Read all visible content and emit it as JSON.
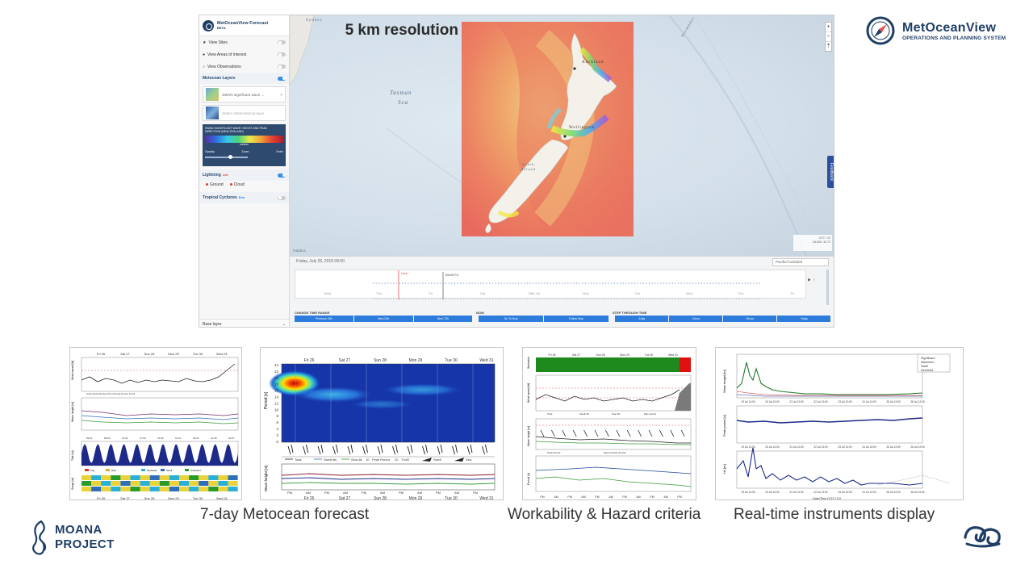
{
  "app": {
    "brand_title": "MetOceanView Forecast",
    "brand_badge": "BETA",
    "menu": [
      {
        "label": "View Sites",
        "icon": "star-icon",
        "on": false
      },
      {
        "label": "View Areas of interest",
        "icon": "circle-filled-icon",
        "on": false
      },
      {
        "label": "View Observations",
        "icon": "circle-outline-icon",
        "on": false
      }
    ],
    "metocean_layers_label": "Metocean Layers",
    "layer_name": "SWAN significant wave ...",
    "observational_placeholder": "Select observational layer",
    "legend_title": "SWAN SIGNIFICANT WAVE HEIGHT AND PEAK DIRECTION (NEW ZEALAND)",
    "legend_unit": "metres",
    "opacity_label": "Opacity",
    "zoom_label": "Zoom",
    "order_label": "Order",
    "lightning_label": "Lightning",
    "lightning_badge": "Live",
    "ground_label": "Ground",
    "cloud_label": "Cloud",
    "cyclones_label": "Tropical Cyclones",
    "cyclones_badge": "Beta",
    "base_layer_label": "Base layer"
  },
  "map": {
    "resolution_label": "5 km resolution",
    "sea_label_1": "Tasman",
    "sea_label_2": "Sea",
    "city_sydney": "Sydney",
    "city_auckland": "Auckland",
    "city_wellington": "Wellington",
    "island_label_1": "South",
    "island_label_2": "Island",
    "kermadec_label": "Kermadec",
    "feedback_label": "Feedback",
    "utc_label": "UTC +12",
    "coords": "-36.845  -40.73",
    "mapbox_label": "mapbox"
  },
  "timeline": {
    "current_date": "Friday, July 26, 2019 09:00",
    "timezone": "Pacific/Auckland",
    "now_label": "Now",
    "cursor_label": "09:00 Fri",
    "day_ticks": [
      "Wed",
      "Thu",
      "Fri",
      "Sat",
      "28th Jul",
      "Mon",
      "Tue",
      "Wed",
      "Thu",
      "Fri"
    ],
    "section_range": "CHANGE TIME RANGE",
    "section_now": "NOW",
    "section_step": "STEP THROUGH TIME",
    "range_buttons": [
      "Previous 24h",
      "Next 24h",
      "Next 72h"
    ],
    "now_buttons": [
      "Go To Now",
      "Follow Now"
    ],
    "step_buttons": [
      "-1day",
      "-1hour",
      "+1hour",
      "+1day"
    ]
  },
  "brand": {
    "name": "MetOceanView",
    "tagline": "OPERATIONS AND PLANNING SYSTEM",
    "moana_line1": "MOANA",
    "moana_line2": "PROJECT"
  },
  "panels": {
    "days": [
      "Fri 26",
      "Sat 27",
      "Sun 28",
      "Mon 29",
      "Tue 30",
      "Wed 31"
    ],
    "tide_times": [
      "05:21",
      "08:34",
      "11:34",
      "17:59",
      "21:00",
      "01:01",
      "06:22",
      "12:38",
      "18:27"
    ],
    "ampm": [
      "PM",
      "AM",
      "PM",
      "AM",
      "PM",
      "AM",
      "PM",
      "AM",
      "PM",
      "AM",
      "PM"
    ],
    "p1_ylabels": [
      "Wind speed [kt]",
      "Wave height [m]",
      "Tide [m]",
      "Surge [m]"
    ],
    "p1_legend_wind": "Total   Swell>8s   Sea<8s  10 Peak Period  Tm02",
    "p1_legend_weather": [
      "Fog",
      "Rain",
      "Moderate",
      "Swell",
      "Unlimited"
    ],
    "p2_ylabel_top": "Period [s]",
    "p2_ylabel_bottom": "Wave height [m]",
    "p2_period_ticks": [
      "24",
      "22",
      "20",
      "18",
      "16",
      "14",
      "12",
      "10",
      "8",
      "6",
      "4",
      "2",
      "0"
    ],
    "p2_legend": [
      "Total",
      "Swell>8s",
      "Sea<8s",
      "10",
      "Peak Period",
      "20",
      "Tm02",
      "Swell",
      "Sea"
    ],
    "p3_ylabels": [
      "Workable",
      "Wind speed [kt]",
      "Wave height [m]",
      "Period [s]"
    ],
    "p3_legend_wind": [
      "Total",
      "Swell>8s",
      "Sea<8s",
      "Max (wind)"
    ],
    "p3_legend_period": [
      "Peak Period",
      "Mean Period (Tm02)"
    ],
    "p4_legend": [
      "Significant",
      "Maximum",
      "Swell",
      "Sea/Infra"
    ],
    "p4_ylabels": [
      "Wave height [m]",
      "Peak period [s]",
      "Hs [m]"
    ],
    "p4_xticks": [
      "19 Jul 12:00",
      "20 Jul 12:00",
      "21 Jul 12:00",
      "22 Jul 12:00",
      "23 Jul 12:00",
      "24 Jul 12:00",
      "25 Jul 12:00",
      "26 Jul 12:00"
    ],
    "p4_xlabel": "Date/Time [UTC+12]"
  },
  "captions": {
    "forecast": "7-day Metocean forecast",
    "workability": "Workability & Hazard criteria",
    "realtime": "Real-time instruments display"
  },
  "colors": {
    "brand_navy": "#1f3e66",
    "accent_blue": "#2d7cdb",
    "timeline_red": "#e0574f",
    "workable_green": "#1e8a1e",
    "hazard_red": "#e01010"
  }
}
